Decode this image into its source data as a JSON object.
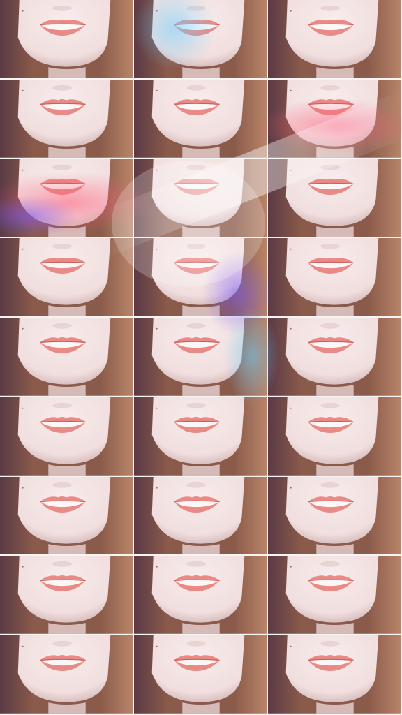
{
  "image": {
    "description_name": "lips-collage",
    "rows": 9,
    "cols": 3
  },
  "colors": {
    "skin": "#f1dede",
    "skin_shadow": "#d9c0c0",
    "lip": "#e98a86",
    "lip_dark": "#c9615e",
    "teeth": "#fbf7f7",
    "hair": "#8a5a4a",
    "hair_light": "#b88468",
    "background": "#5a3a46"
  }
}
